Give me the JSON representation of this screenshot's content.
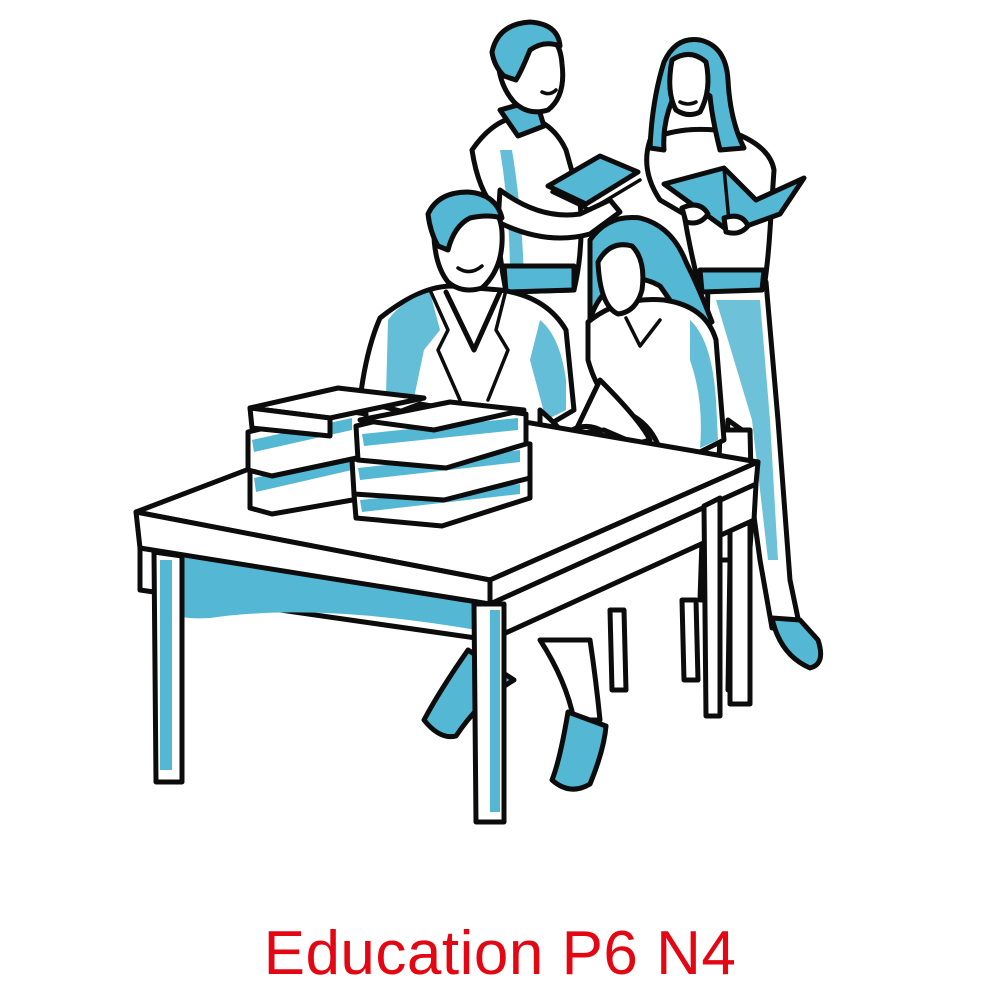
{
  "caption": "Education P6 N4",
  "colors": {
    "ink": "#0c0c0c",
    "tint": "#54b7d3",
    "paper": "#ffffff",
    "caption": "#e30613"
  },
  "illustration": {
    "subject_icons": [
      "table-icon",
      "book-stack-icon",
      "open-book-icon",
      "person-icon"
    ]
  }
}
